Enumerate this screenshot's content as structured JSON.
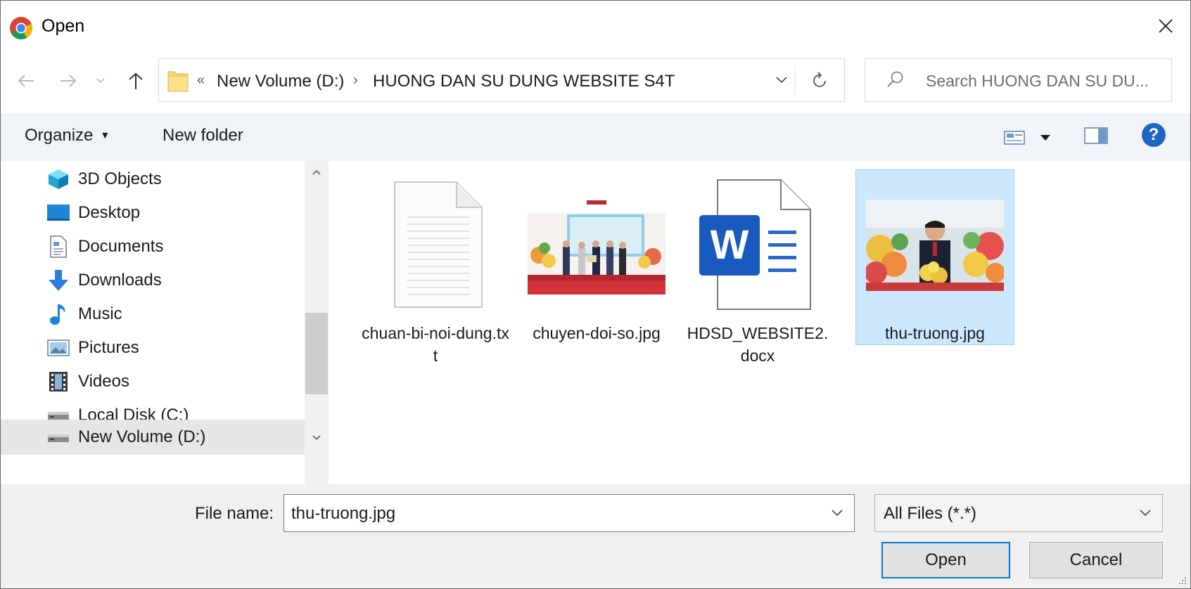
{
  "window": {
    "title": "Open",
    "app_icon": "chrome-icon",
    "close_glyph": "✕"
  },
  "address_bar": {
    "overflow_glyph": "«",
    "crumbs": [
      "New Volume (D:)",
      "HUONG DAN SU DUNG WEBSITE S4T"
    ],
    "separator": "›"
  },
  "search": {
    "placeholder": "Search HUONG DAN SU DU..."
  },
  "commandbar": {
    "organize_label": "Organize",
    "new_folder_label": "New folder",
    "help_label": "?"
  },
  "sidebar": {
    "items": [
      {
        "label": "3D Objects",
        "icon": "3d-objects-icon"
      },
      {
        "label": "Desktop",
        "icon": "desktop-icon"
      },
      {
        "label": "Documents",
        "icon": "documents-icon"
      },
      {
        "label": "Downloads",
        "icon": "downloads-icon"
      },
      {
        "label": "Music",
        "icon": "music-icon"
      },
      {
        "label": "Pictures",
        "icon": "pictures-icon"
      },
      {
        "label": "Videos",
        "icon": "videos-icon"
      },
      {
        "label": "Local Disk (C:)",
        "icon": "drive-icon"
      },
      {
        "label": "New Volume (D:)",
        "icon": "drive-icon",
        "selected": true
      }
    ]
  },
  "files": [
    {
      "name": "chuan-bi-noi-dung.txt",
      "type": "txt",
      "icon": "text-file-icon",
      "selected": false
    },
    {
      "name": "chuyen-doi-so.jpg",
      "type": "jpg",
      "icon": "image-thumbnail",
      "selected": false
    },
    {
      "name": "HDSD_WEBSITE2.docx",
      "type": "docx",
      "icon": "word-document-icon",
      "selected": false
    },
    {
      "name": "thu-truong.jpg",
      "type": "jpg",
      "icon": "image-thumbnail",
      "selected": true
    }
  ],
  "footer": {
    "file_name_label": "File name:",
    "file_name_value": "thu-truong.jpg",
    "file_type_value": "All Files (*.*)",
    "open_label": "Open",
    "cancel_label": "Cancel"
  },
  "colors": {
    "accent": "#0078d7",
    "selection_fill": "#cce8ff",
    "selection_border": "#99d1ff",
    "word_blue": "#185abd",
    "help_blue": "#1f66c2"
  }
}
